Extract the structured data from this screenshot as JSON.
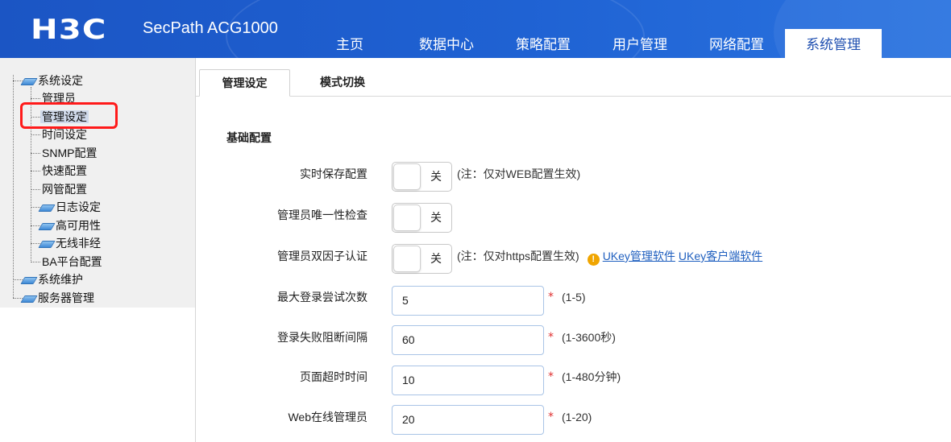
{
  "header": {
    "logo": "H3C",
    "product": "SecPath ACG1000",
    "nav": [
      "主页",
      "数据中心",
      "策略配置",
      "用户管理",
      "网络配置",
      "系统管理"
    ],
    "active_nav": "系统管理"
  },
  "sidebar": {
    "items": [
      {
        "label": "系统设定",
        "level": 0,
        "folder": true
      },
      {
        "label": "管理员",
        "level": 1,
        "folder": false
      },
      {
        "label": "管理设定",
        "level": 1,
        "folder": false,
        "selected": true
      },
      {
        "label": "时间设定",
        "level": 1,
        "folder": false
      },
      {
        "label": "SNMP配置",
        "level": 1,
        "folder": false
      },
      {
        "label": "快速配置",
        "level": 1,
        "folder": false
      },
      {
        "label": "网管配置",
        "level": 1,
        "folder": false
      },
      {
        "label": "日志设定",
        "level": 1,
        "folder": true
      },
      {
        "label": "高可用性",
        "level": 1,
        "folder": true
      },
      {
        "label": "无线非经",
        "level": 1,
        "folder": true
      },
      {
        "label": "BA平台配置",
        "level": 1,
        "folder": false
      },
      {
        "label": "系统维护",
        "level": 0,
        "folder": true
      },
      {
        "label": "服务器管理",
        "level": 0,
        "folder": true
      }
    ]
  },
  "subtabs": {
    "active": "管理设定",
    "inactive": "模式切换"
  },
  "form": {
    "section_title": "基础配置",
    "realtime_save": {
      "label": "实时保存配置",
      "state": "关",
      "note": "(注：仅对WEB配置生效)"
    },
    "admin_unique": {
      "label": "管理员唯一性检查",
      "state": "关"
    },
    "admin_2fa": {
      "label": "管理员双因子认证",
      "state": "关",
      "note": "(注：仅对https配置生效)",
      "warn_icon": "!",
      "link1": "UKey管理软件",
      "link2": "UKey客户端软件"
    },
    "max_login": {
      "label": "最大登录尝试次数",
      "value": "5",
      "required": "*",
      "range": "(1-5)"
    },
    "login_block": {
      "label": "登录失败阻断间隔",
      "value": "60",
      "required": "*",
      "range": "(1-3600秒)"
    },
    "page_timeout": {
      "label": "页面超时时间",
      "value": "10",
      "required": "*",
      "range": "(1-480分钟)"
    },
    "web_admins": {
      "label": "Web在线管理员",
      "value": "20",
      "required": "*",
      "range": "(1-20)"
    }
  },
  "colors": {
    "header": "#1f5fd0",
    "highlight": "#ff1a1a",
    "link": "#1f5fbf",
    "required": "#e03030"
  }
}
